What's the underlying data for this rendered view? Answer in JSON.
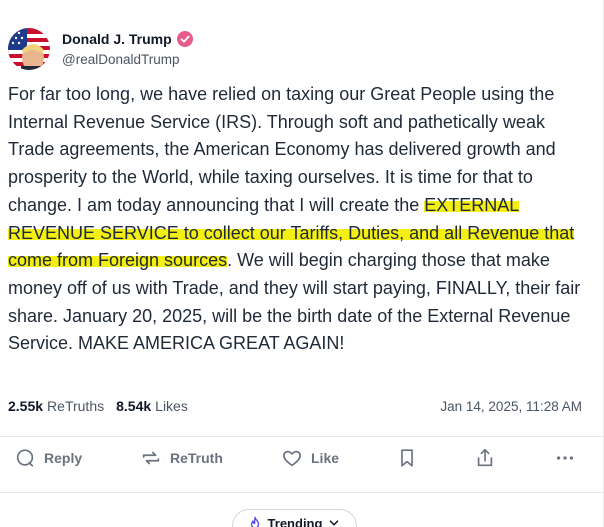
{
  "author": {
    "display_name": "Donald J. Trump",
    "handle": "@realDonaldTrump",
    "verified": true,
    "verified_color": "#e75b8b"
  },
  "post": {
    "text_before": "For far too long, we have relied on taxing our Great People using the Internal Revenue Service (IRS). Through soft and pathetically weak Trade agreements, the American Economy has delivered growth and prosperity to the World, while taxing ourselves. It is time for that to change. I am today announcing that I will create the ",
    "text_highlighted": "EXTERNAL REVENUE SERVICE to collect our Tariffs, Duties, and all Revenue that come from Foreign sources",
    "text_after": ". We will begin charging those that make money off of us with Trade, and they will start paying, FINALLY, their fair share. January 20, 2025, will be the birth date of the External Revenue Service. MAKE AMERICA GREAT AGAIN!",
    "highlight_color": "#f4ef13"
  },
  "stats": {
    "retruths_count": "2.55k",
    "retruths_label": "ReTruths",
    "likes_count": "8.54k",
    "likes_label": "Likes",
    "timestamp": "Jan 14, 2025, 11:28 AM"
  },
  "actions": {
    "reply_label": "Reply",
    "retruth_label": "ReTruth",
    "like_label": "Like"
  },
  "trending": {
    "label": "Trending"
  },
  "icons": {
    "reply": "reply-icon",
    "retruth": "retruth-icon",
    "like": "heart-icon",
    "bookmark": "bookmark-icon",
    "share": "share-icon",
    "more": "more-icon",
    "trending": "trending-icon",
    "chevron": "chevron-down-icon"
  }
}
